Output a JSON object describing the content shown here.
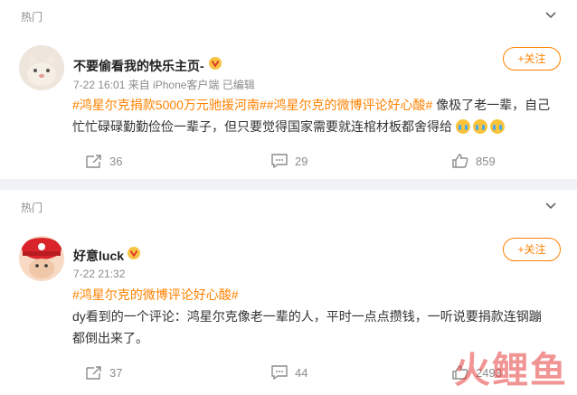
{
  "posts": [
    {
      "hot_label": "热门",
      "username": "不要偷看我的快乐主页-",
      "meta": "7-22 16:01 来自 iPhone客户端 已编辑",
      "follow_label": "+关注",
      "tags": "#鸿星尔克捐款5000万元驰援河南##鸿星尔克的微博评论好心酸#",
      "text": "像极了老一辈，自己忙忙碌碌勤勤俭俭一辈子，但只要觉得国家需要就连棺材板都舍得给",
      "reposts": "36",
      "comments": "29",
      "likes": "859"
    },
    {
      "hot_label": "热门",
      "username": "好意luck",
      "meta": "7-22 21:32",
      "follow_label": "+关注",
      "tags": "#鸿星尔克的微博评论好心酸#",
      "text": "dy看到的一个评论：鸿星尔克像老一辈的人，平时一点点攒钱，一听说要捐款连钢蹦都倒出来了。",
      "reposts": "37",
      "comments": "44",
      "likes": "2493"
    }
  ],
  "watermark": "火鲤鱼",
  "colors": {
    "accent": "#ff8200",
    "muted": "#8c8c8c",
    "text": "#333333",
    "background": "#f1f2f5"
  },
  "icons": [
    "chevron-down-icon",
    "vip-badge-icon",
    "repost-icon",
    "comment-icon",
    "like-icon",
    "cry-emoji-icon"
  ]
}
